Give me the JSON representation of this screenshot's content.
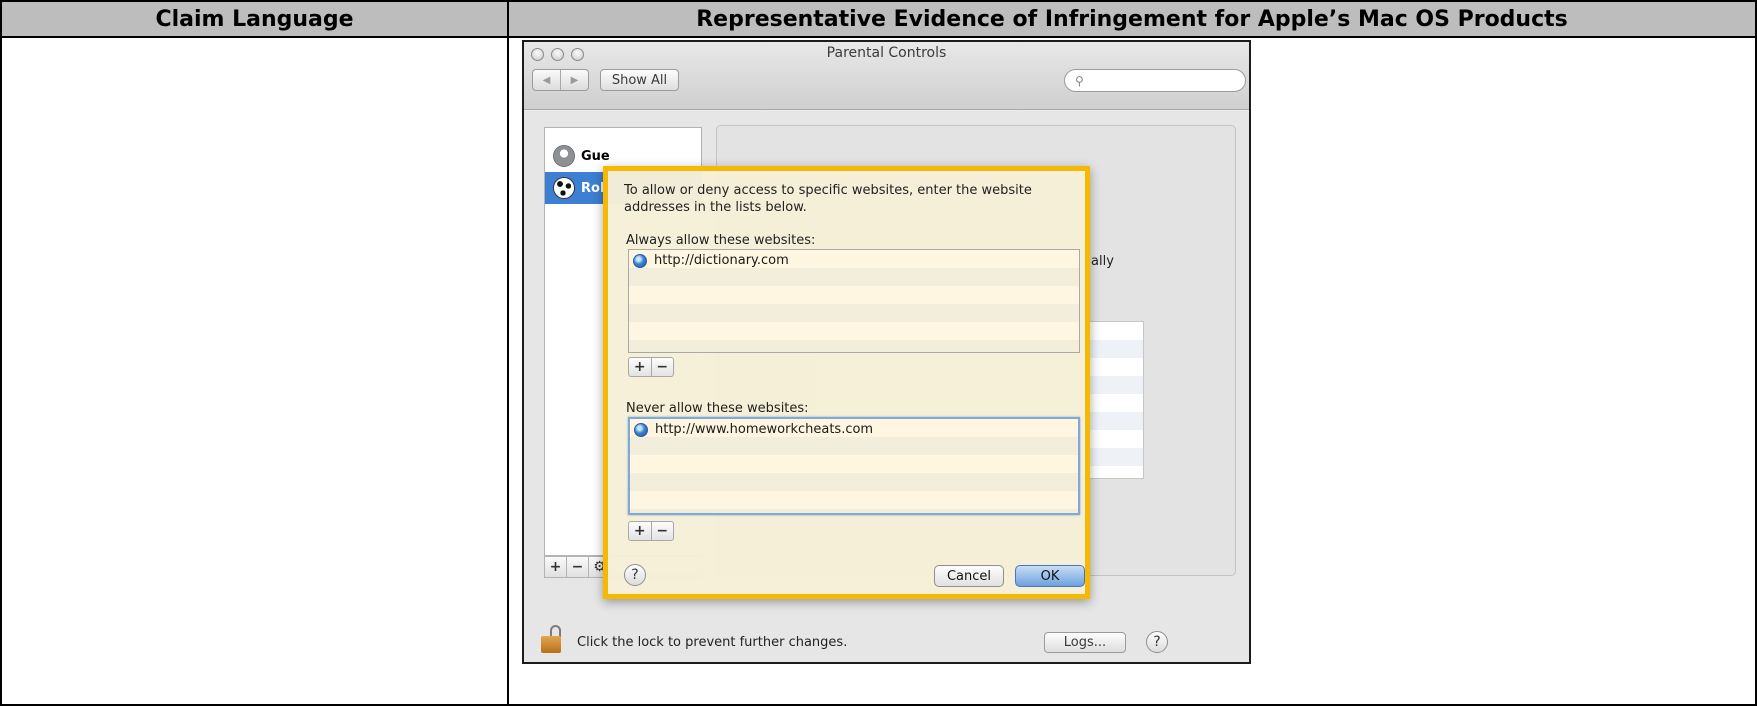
{
  "table": {
    "col1_header": "Claim Language",
    "col2_header": "Representative Evidence of Infringement for Apple’s Mac OS Products"
  },
  "window": {
    "title": "Parental Controls",
    "show_all": "Show All",
    "search_placeholder": ""
  },
  "sidebar": {
    "users": [
      {
        "label": "Gue",
        "avatar": "guest-icon"
      },
      {
        "label": "Roll",
        "avatar": "soccer-ball-icon"
      }
    ],
    "tools": [
      "+",
      "−",
      "⚙"
    ]
  },
  "background_panel": {
    "partial_text": "ally"
  },
  "dialog": {
    "instruction": "To allow or deny access to specific websites, enter the website addresses in the lists below.",
    "always_label": "Always allow these websites:",
    "always_sites": [
      "http://dictionary.com"
    ],
    "never_label": "Never allow these websites:",
    "never_sites": [
      "http://www.homeworkcheats.com"
    ],
    "add": "+",
    "remove": "−",
    "help": "?",
    "cancel": "Cancel",
    "ok": "OK"
  },
  "footer": {
    "lock_text": "Click the lock to prevent further changes.",
    "logs": "Logs...",
    "help": "?"
  },
  "colors": {
    "highlight_border": "#f6b800",
    "selection": "#3d7fd3"
  }
}
